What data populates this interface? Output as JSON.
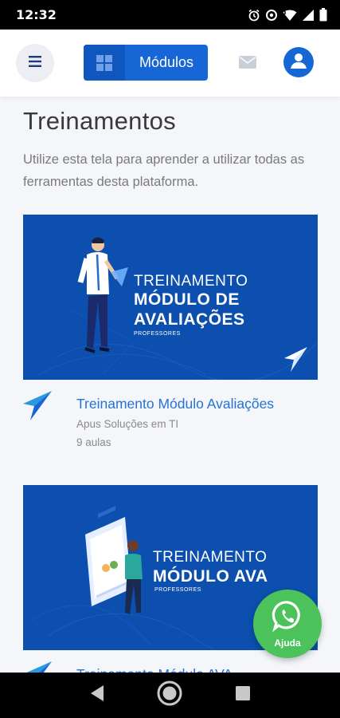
{
  "status_bar": {
    "time": "12:32",
    "icons": [
      "alarm-icon",
      "data-saver-icon",
      "wifi-icon",
      "signal-icon",
      "battery-icon"
    ]
  },
  "app_bar": {
    "menu_icon": "hamburger-icon",
    "modules_label": "Módulos",
    "modules_icon": "grid-icon",
    "mail_icon": "mail-icon",
    "avatar_icon": "user-icon"
  },
  "page": {
    "title": "Treinamentos",
    "description": "Utilize esta tela para aprender a utilizar todas as ferramentas desta plataforma."
  },
  "trainings": [
    {
      "banner": {
        "line1": "TREINAMENTO",
        "line2a": "MÓDULO DE",
        "line2b": "AVALIAÇÕES",
        "sub": "PROFESSORES"
      },
      "title": "Treinamento Módulo Avaliações",
      "author": "Apus Soluções em TI",
      "lessons": "9 aulas"
    },
    {
      "banner": {
        "line1": "TREINAMENTO",
        "line2a": "MÓDULO AVA",
        "sub": "PROFESSORES"
      },
      "title": "Treinamento Módulo AVA"
    }
  ],
  "help_button": {
    "label": "Ajuda",
    "icon": "whatsapp-icon",
    "color": "#4cc35a"
  },
  "colors": {
    "primary": "#1766d6",
    "banner": "#0c4fae",
    "link": "#2672d6"
  },
  "nav_bar": {
    "icons": [
      "back-icon",
      "home-icon",
      "recents-icon"
    ]
  }
}
